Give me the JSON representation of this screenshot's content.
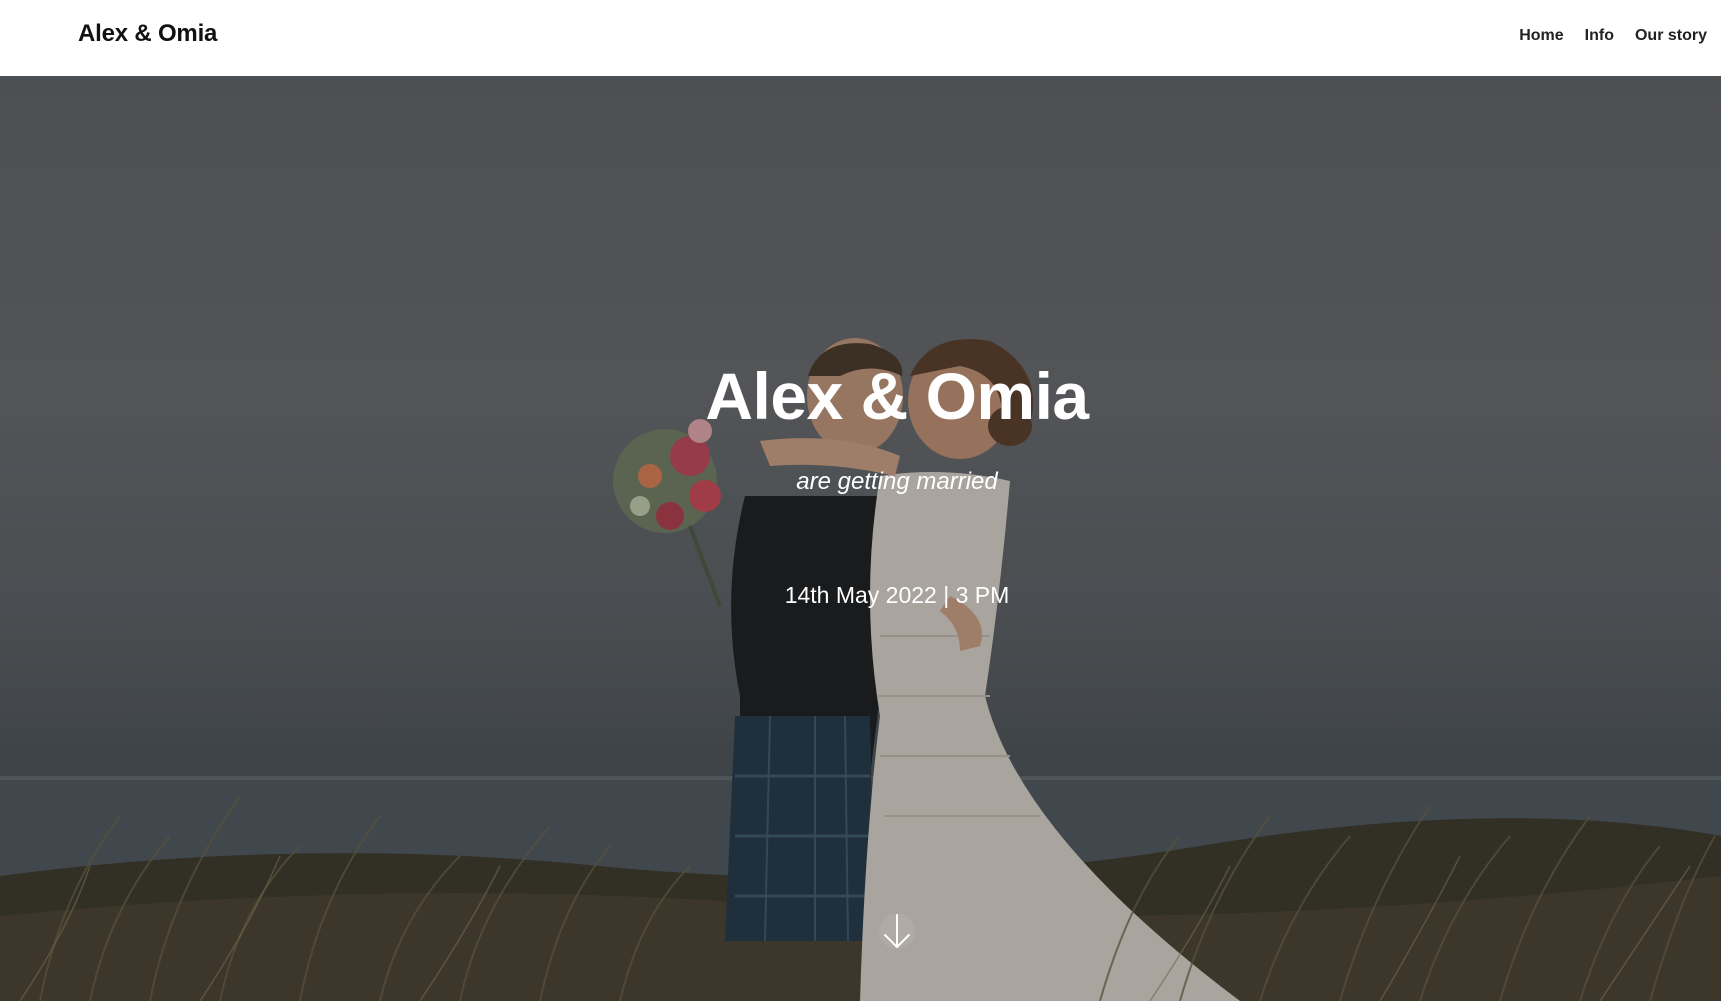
{
  "navbar": {
    "brand": "Alex & Omia",
    "links": [
      {
        "label": "Home"
      },
      {
        "label": "Info"
      },
      {
        "label": "Our story"
      }
    ]
  },
  "hero": {
    "title": "Alex & Omia",
    "subtitle": "are getting married",
    "date": "14th May 2022 | 3 PM",
    "scroll_icon": "arrow-down-icon"
  },
  "colors": {
    "navbar_bg": "#ffffff",
    "brand_text": "#111111",
    "hero_text": "#ffffff"
  }
}
